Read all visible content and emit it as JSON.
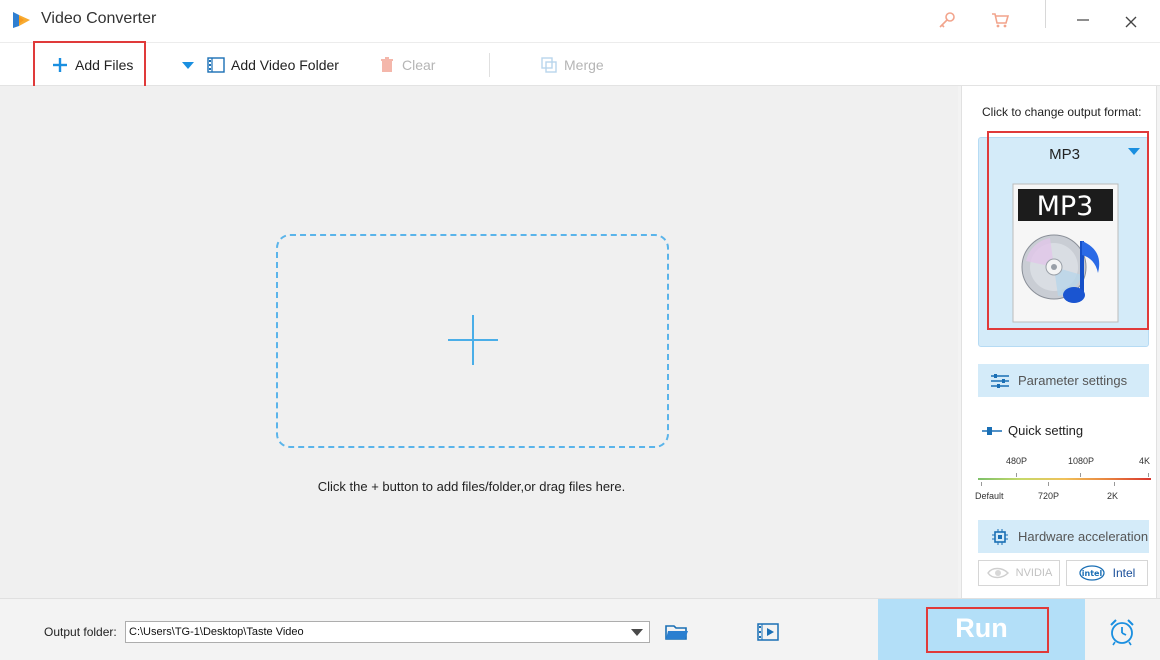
{
  "window": {
    "title": "Video Converter"
  },
  "toolbar": {
    "add_files": "Add Files",
    "add_video_folder": "Add Video Folder",
    "clear": "Clear",
    "merge": "Merge"
  },
  "main": {
    "hint": "Click the + button to add files/folder,or drag files here."
  },
  "output_panel": {
    "label": "Click to change output format:",
    "format": "MP3",
    "format_icon_text": "MP3",
    "parameter_settings": "Parameter settings",
    "quick_setting": "Quick setting",
    "quality_ticks_top": [
      "480P",
      "1080P",
      "4K"
    ],
    "quality_ticks_bottom": [
      "Default",
      "720P",
      "2K"
    ],
    "hardware_acceleration": "Hardware acceleration",
    "nvidia": "NVIDIA",
    "intel": "Intel",
    "intel_logo_text": "intel"
  },
  "footer": {
    "output_folder_label": "Output folder:",
    "output_folder_value": "C:\\Users\\TG-1\\Desktop\\Taste Video",
    "run": "Run"
  },
  "colors": {
    "accent": "#1a8fe0",
    "highlight_box": "#e03a3a",
    "run_bg": "#b3dff8",
    "panel_card": "#d4ebf9"
  }
}
